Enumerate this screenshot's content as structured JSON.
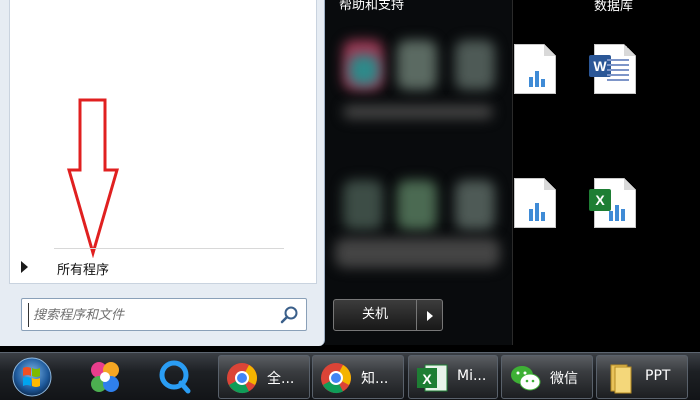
{
  "start_menu": {
    "all_programs_label": "所有程序",
    "search_placeholder": "搜索程序和文件",
    "right_link_label": "帮助和支持",
    "shutdown_label": "关机"
  },
  "desktop": {
    "top_label": "数据库",
    "icons": [
      {
        "name": "excel-file-icon"
      },
      {
        "name": "word-file-icon"
      },
      {
        "name": "excel-file-icon"
      },
      {
        "name": "excel-file-icon"
      }
    ]
  },
  "taskbar": {
    "buttons": [
      {
        "label": "全..."
      },
      {
        "label": "知..."
      },
      {
        "label": "Mi..."
      },
      {
        "label": "微信"
      },
      {
        "label": "PPT"
      }
    ]
  },
  "colors": {
    "red_arrow": "#e02020",
    "excel_green": "#1e7e34",
    "word_blue": "#2b5797",
    "wechat_green": "#3eb035",
    "taskbar_bg": "#1d2024"
  }
}
